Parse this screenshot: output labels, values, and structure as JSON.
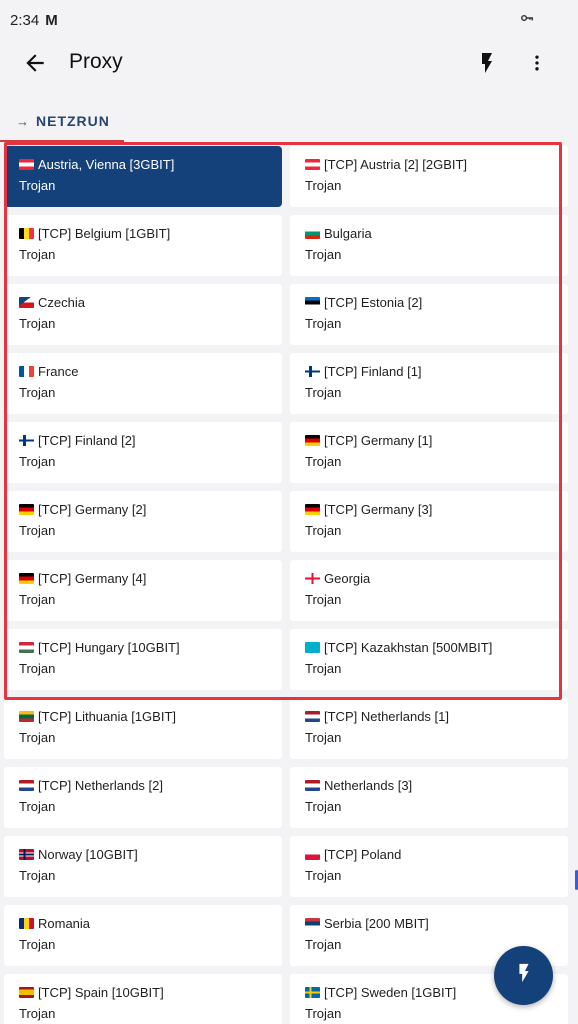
{
  "status": {
    "time": "2:34",
    "mail_icon": "M"
  },
  "app_bar": {
    "title": "Proxy"
  },
  "tab": {
    "arrow": "→",
    "label": "NETZRUN"
  },
  "colors": {
    "accent": "#14417a",
    "highlight": "#e53340",
    "tab_underline": "#d43b3b"
  },
  "servers": [
    {
      "name": "Austria, Vienna [3GBIT]",
      "type": "Trojan",
      "flag": "at",
      "selected": true
    },
    {
      "name": "[TCP] Austria [2] [2GBIT]",
      "type": "Trojan",
      "flag": "at"
    },
    {
      "name": "[TCP] Belgium [1GBIT]",
      "type": "Trojan",
      "flag": "be"
    },
    {
      "name": "Bulgaria",
      "type": "Trojan",
      "flag": "bg"
    },
    {
      "name": "Czechia",
      "type": "Trojan",
      "flag": "cz"
    },
    {
      "name": "[TCP] Estonia [2]",
      "type": "Trojan",
      "flag": "ee"
    },
    {
      "name": "France",
      "type": "Trojan",
      "flag": "fr"
    },
    {
      "name": "[TCP] Finland [1]",
      "type": "Trojan",
      "flag": "fi"
    },
    {
      "name": "[TCP] Finland [2]",
      "type": "Trojan",
      "flag": "fi"
    },
    {
      "name": "[TCP] Germany [1]",
      "type": "Trojan",
      "flag": "de"
    },
    {
      "name": "[TCP] Germany [2]",
      "type": "Trojan",
      "flag": "de"
    },
    {
      "name": "[TCP] Germany [3]",
      "type": "Trojan",
      "flag": "de"
    },
    {
      "name": "[TCP] Germany [4]",
      "type": "Trojan",
      "flag": "de"
    },
    {
      "name": "Georgia",
      "type": "Trojan",
      "flag": "ge"
    },
    {
      "name": "[TCP] Hungary [10GBIT]",
      "type": "Trojan",
      "flag": "hu"
    },
    {
      "name": "[TCP] Kazakhstan [500MBIT]",
      "type": "Trojan",
      "flag": "kz"
    },
    {
      "name": "[TCP] Lithuania [1GBIT]",
      "type": "Trojan",
      "flag": "lt"
    },
    {
      "name": "[TCP] Netherlands [1]",
      "type": "Trojan",
      "flag": "nl"
    },
    {
      "name": "[TCP] Netherlands [2]",
      "type": "Trojan",
      "flag": "nl"
    },
    {
      "name": "Netherlands [3]",
      "type": "Trojan",
      "flag": "nl"
    },
    {
      "name": "Norway [10GBIT]",
      "type": "Trojan",
      "flag": "no"
    },
    {
      "name": "[TCP] Poland",
      "type": "Trojan",
      "flag": "pl"
    },
    {
      "name": "Romania",
      "type": "Trojan",
      "flag": "ro"
    },
    {
      "name": "Serbia [200 MBIT]",
      "type": "Trojan",
      "flag": "rs"
    },
    {
      "name": "[TCP] Spain [10GBIT]",
      "type": "Trojan",
      "flag": "es"
    },
    {
      "name": "[TCP] Sweden [1GBIT]",
      "type": "Trojan",
      "flag": "se"
    }
  ]
}
